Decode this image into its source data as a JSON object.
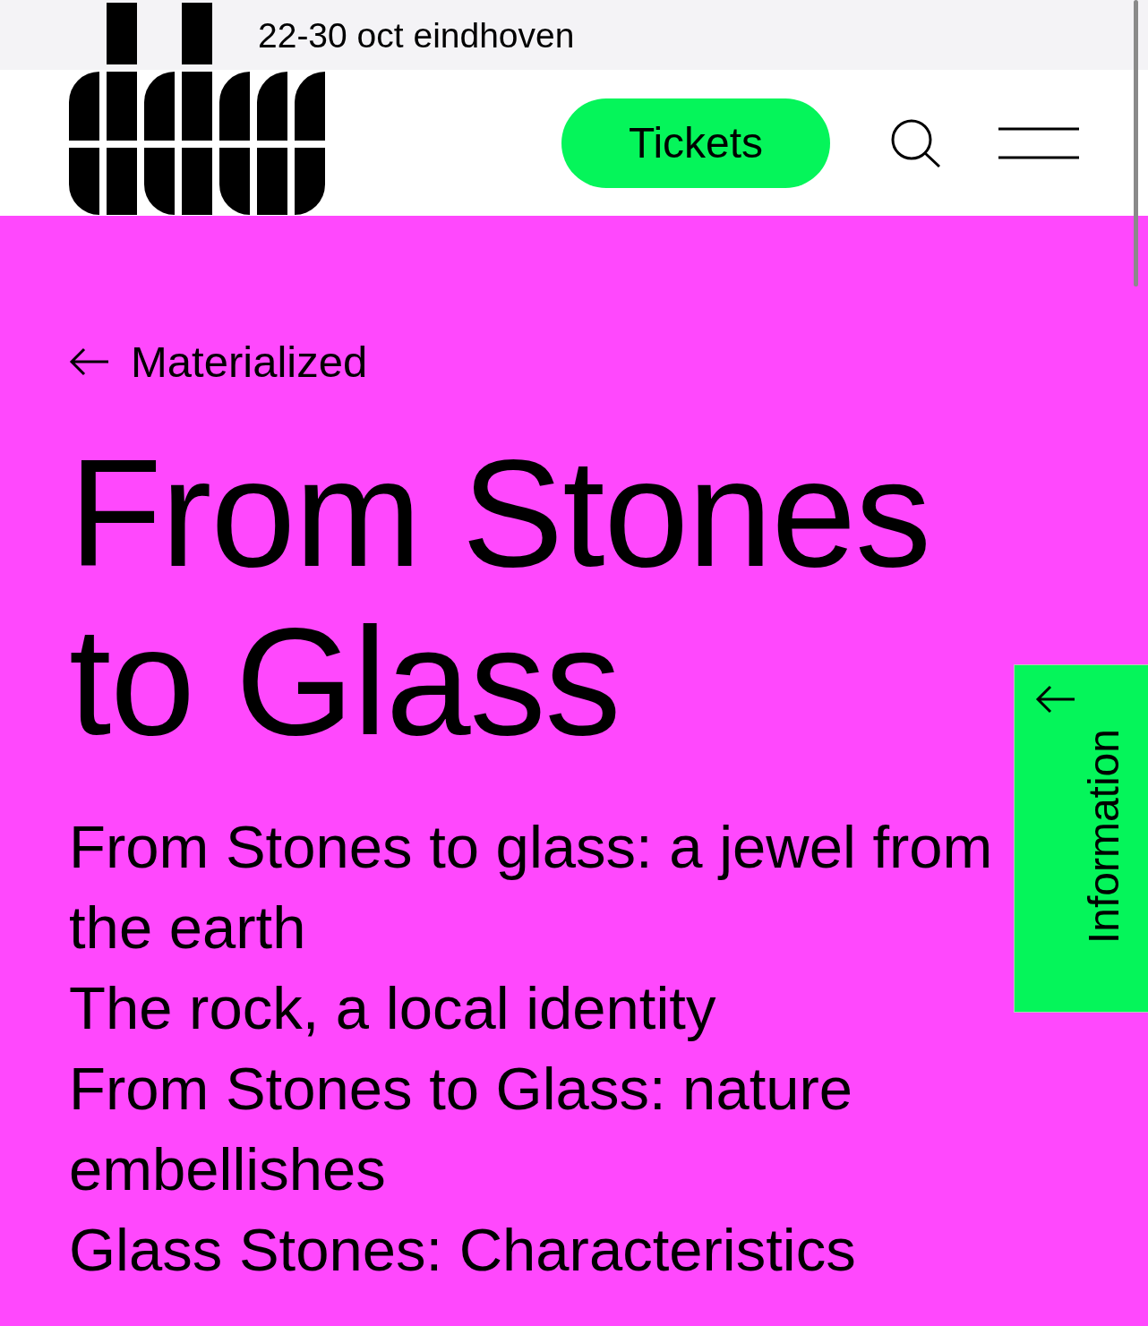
{
  "top_bar": {
    "dates": "22-30 oct eindhoven"
  },
  "header": {
    "tickets_button": "Tickets"
  },
  "back_link": {
    "label": "Materialized"
  },
  "title": "From Stones to Glass",
  "sections": [
    "From Stones to glass: a jewel from the earth",
    "The rock, a local identity",
    "From Stones to Glass: nature embellishes",
    "Glass Stones: Characteristics"
  ],
  "side_tab": {
    "label": "Information"
  }
}
